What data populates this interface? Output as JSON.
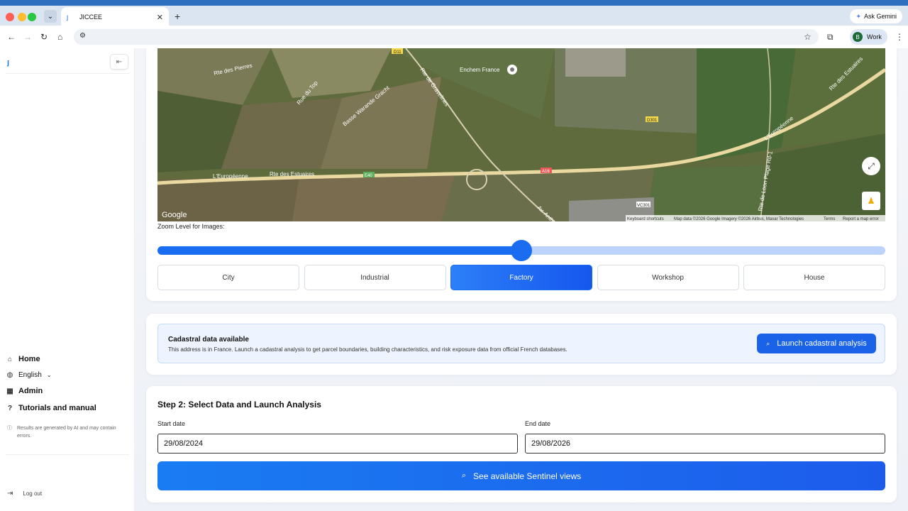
{
  "browser": {
    "tab_title": "JICCEE",
    "gemini_label": "Ask Gemini",
    "profile_initial": "B",
    "profile_label": "Work"
  },
  "sidebar": {
    "nav": [
      {
        "label": "Home",
        "icon": "home-icon"
      },
      {
        "label": "English",
        "icon": "globe-icon"
      },
      {
        "label": "Admin",
        "icon": "grid-icon"
      },
      {
        "label": "Tutorials and manual",
        "icon": "help-icon"
      }
    ],
    "disclaimer": "Results are generated by AI and may contain errors.",
    "logout": "Log out"
  },
  "map": {
    "labels": {
      "enchem": "Enchem France",
      "pierres": "Rte des Pierres",
      "gravelines": "Rte de Gravelines",
      "europeenne_left": "L'Européenne",
      "estuaires": "Rte des Estuaires",
      "europeenne_right": "L'Européenne",
      "estuaires_right": "Rte des Estuaires",
      "loon": "Rte de Loon Plage Rd-1",
      "anthony": "Av. Anthony",
      "du_top": "Rue du Top",
      "basse": "Basse Warande Gracht",
      "d11": "D11",
      "d301": "D301",
      "a16": "A16",
      "e40": "E40",
      "vc301": "VC301"
    },
    "google": "Google",
    "attribution": {
      "keyboard": "Keyboard shortcuts",
      "mapdata": "Map data ©2026 Google Imagery ©2026 Airbus, Maxar Technologies",
      "terms": "Terms",
      "report": "Report a map error"
    }
  },
  "zoom": {
    "label": "Zoom Level for Images:",
    "level": 0.5,
    "options": [
      "City",
      "Industrial",
      "Factory",
      "Workshop",
      "House"
    ],
    "selected": "Factory"
  },
  "cadastral": {
    "title": "Cadastral data available",
    "description": "This address is in France. Launch a cadastral analysis to get parcel boundaries, building characteristics, and risk exposure data from official French databases.",
    "button": "Launch cadastral analysis"
  },
  "step2": {
    "title": "Step 2: Select Data and Launch Analysis",
    "start_label": "Start date",
    "start_value": "29/08/2024",
    "end_label": "End date",
    "end_value": "29/08/2026",
    "button": "See available Sentinel views"
  },
  "colors": {
    "accent": "#1a6cf0"
  }
}
